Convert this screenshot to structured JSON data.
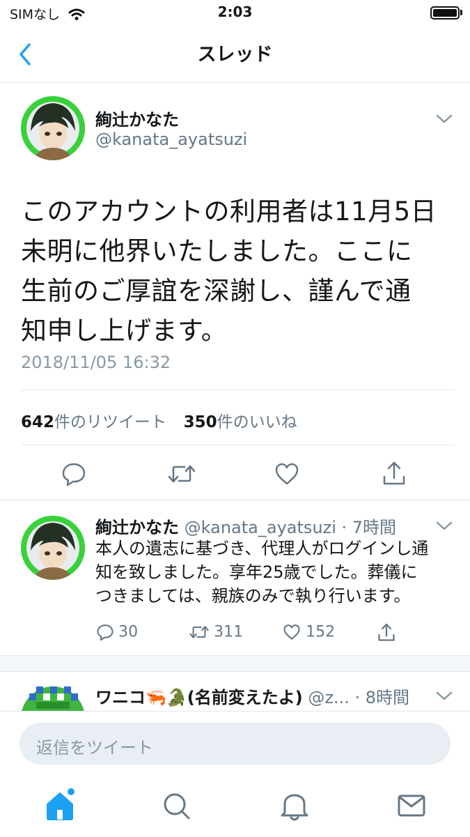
{
  "status_bar": {
    "carrier": "SIMなし",
    "time": "2:03"
  },
  "nav": {
    "title": "スレッド"
  },
  "main_tweet": {
    "name": "絢辻かなた",
    "handle": "@kanata_ayatsuzi",
    "lines": [
      "このアカウントの利用者は11月5日",
      "未明に他界いたしました。ここに",
      "生前のご厚誼を深謝し、謹んで通",
      "知申し上げます。"
    ],
    "timestamp": "2018/11/05 16:32",
    "retweets_count": "642",
    "retweets_label": "件のリツイート",
    "likes_count": "350",
    "likes_label": "件のいいね"
  },
  "reply_tweet": {
    "name": "絢辻かなた",
    "handle_time": "@kanata_ayatsuzi · 7時間",
    "lines": [
      "本人の遺志に基づき、代理人がログインし通",
      "知を致しました。享年25歳でした。葬儀に",
      "つきましては、親族のみで執り行います。"
    ],
    "replies": "30",
    "retweets": "311",
    "likes": "152"
  },
  "third_tweet": {
    "name": "ワニコ🦐🐊(名前変えたよ)",
    "handle_time": "@z... · 8時間"
  },
  "compose": {
    "placeholder": "返信をツイート"
  },
  "colors": {
    "accent": "#1da1f2",
    "muted": "#657786",
    "avatar_green": "#38d13a"
  },
  "icons": [
    "back-chevron-icon",
    "caret-down-icon",
    "reply-icon",
    "retweet-icon",
    "like-icon",
    "share-icon",
    "home-icon",
    "search-icon",
    "notifications-icon",
    "messages-icon"
  ]
}
